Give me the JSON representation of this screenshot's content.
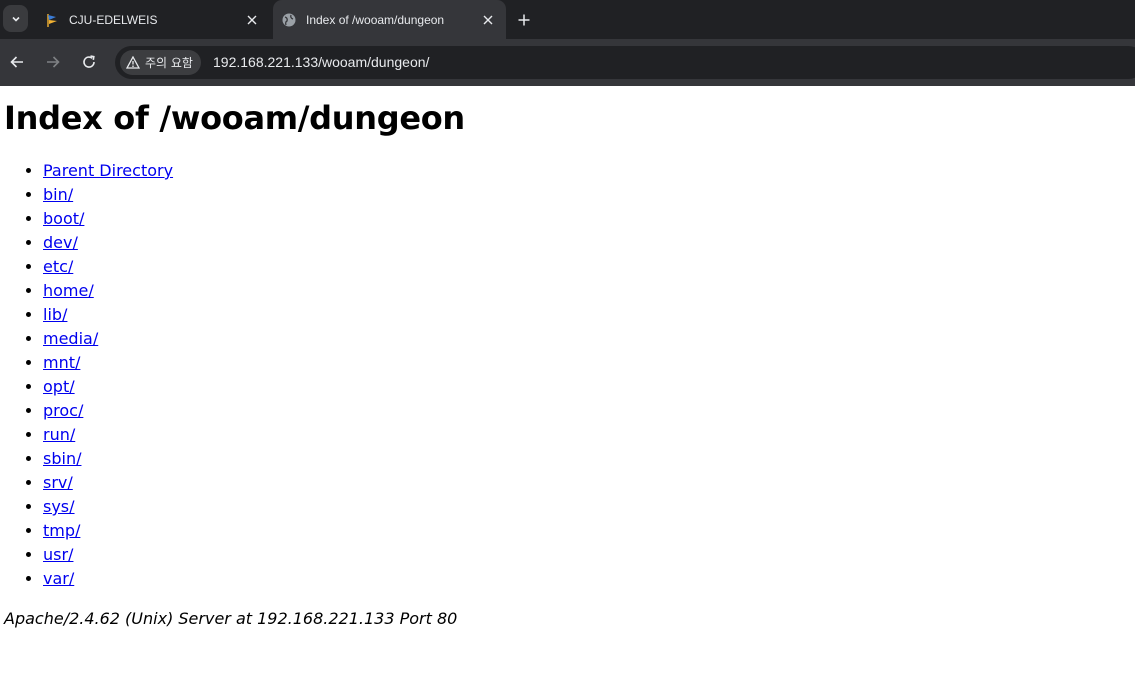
{
  "browser": {
    "tabs": [
      {
        "title": "CJU-EDELWEIS",
        "active": false,
        "favicon": "flag-favicon-icon"
      },
      {
        "title": "Index of /wooam/dungeon",
        "active": true,
        "favicon": "globe-favicon-icon"
      }
    ],
    "security_label": "주의 요함",
    "url": "192.168.221.133/wooam/dungeon/"
  },
  "page": {
    "title": "Index of /wooam/dungeon",
    "entries": [
      "Parent Directory",
      "bin/",
      "boot/",
      "dev/",
      "etc/",
      "home/",
      "lib/",
      "media/",
      "mnt/",
      "opt/",
      "proc/",
      "run/",
      "sbin/",
      "srv/",
      "sys/",
      "tmp/",
      "usr/",
      "var/"
    ],
    "server_signature": "Apache/2.4.62 (Unix) Server at 192.168.221.133 Port 80"
  },
  "colors": {
    "link": "#0000ee",
    "tabstrip": "#202124",
    "toolbar": "#35363a"
  }
}
